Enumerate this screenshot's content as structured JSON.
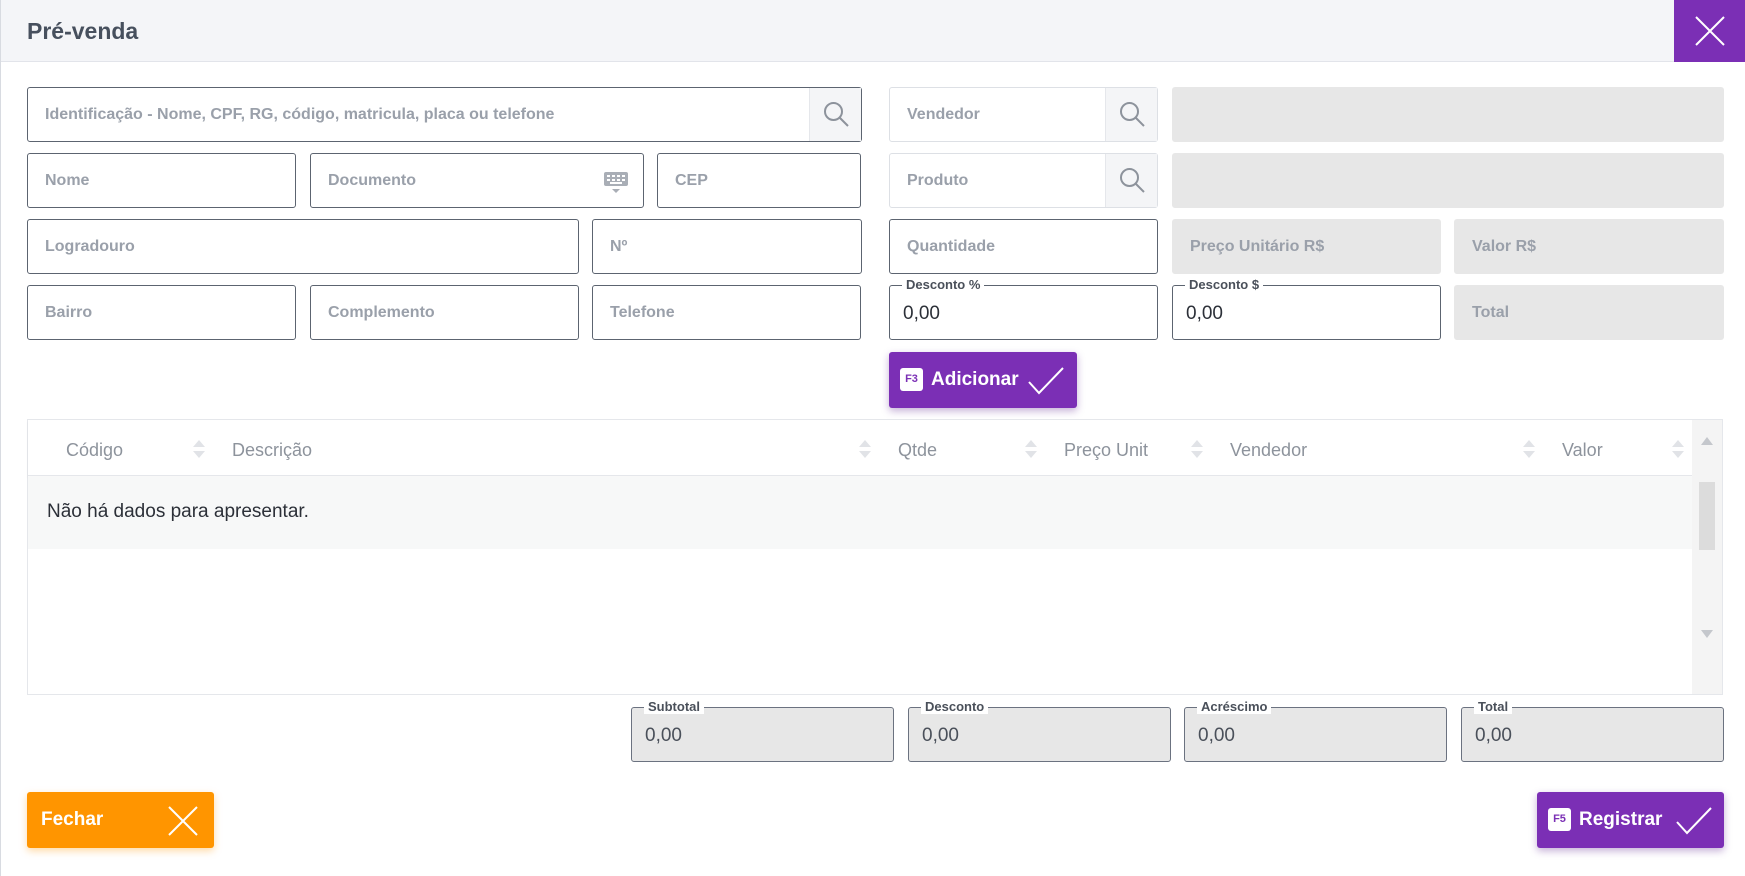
{
  "header": {
    "title": "Pré-venda"
  },
  "customer": {
    "identification_placeholder": "Identificação - Nome, CPF, RG, código, matricula, placa ou telefone",
    "name_placeholder": "Nome",
    "document_placeholder": "Documento",
    "cep_placeholder": "CEP",
    "street_placeholder": "Logradouro",
    "number_placeholder": "Nº",
    "district_placeholder": "Bairro",
    "complement_placeholder": "Complemento",
    "phone_placeholder": "Telefone"
  },
  "item": {
    "seller_placeholder": "Vendedor",
    "product_placeholder": "Produto",
    "quantity_placeholder": "Quantidade",
    "unit_price_placeholder": "Preço Unitário R$",
    "value_placeholder": "Valor R$",
    "discount_pct_label": "Desconto %",
    "discount_pct_value": "0,00",
    "discount_abs_label": "Desconto $",
    "discount_abs_value": "0,00",
    "total_placeholder": "Total",
    "add_button": {
      "key": "F3",
      "label": "Adicionar"
    }
  },
  "grid": {
    "columns": [
      "Código",
      "Descrição",
      "Qtde",
      "Preço Unit",
      "Vendedor",
      "Valor"
    ],
    "empty_message": "Não há dados para apresentar."
  },
  "summary": {
    "subtotal_label": "Subtotal",
    "subtotal_value": "0,00",
    "discount_label": "Desconto",
    "discount_value": "0,00",
    "surcharge_label": "Acréscimo",
    "surcharge_value": "0,00",
    "total_label": "Total",
    "total_value": "0,00"
  },
  "footer": {
    "close_label": "Fechar",
    "register_button": {
      "key": "F5",
      "label": "Registrar"
    }
  },
  "colors": {
    "accent": "#7b2fb5",
    "close": "#ff9500",
    "disabled": "#e7e7e7"
  }
}
